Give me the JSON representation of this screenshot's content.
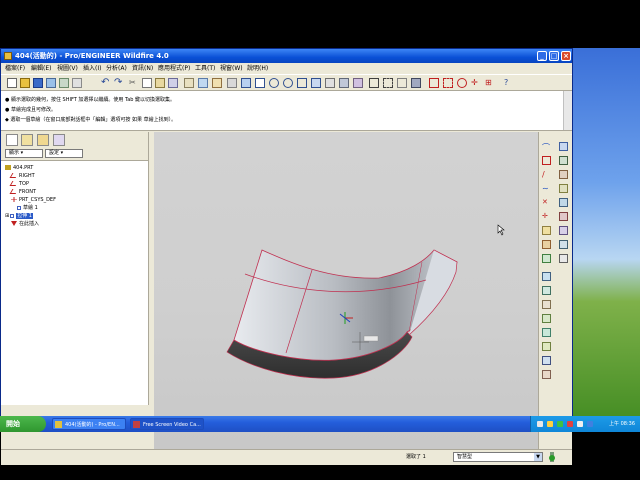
{
  "window": {
    "title": "404(活動的) - Pro/ENGINEER Wildfire 4.0"
  },
  "menu": {
    "items": [
      "檔案(F)",
      "編輯(E)",
      "視圖(V)",
      "插入(I)",
      "分析(A)",
      "資訊(N)",
      "應用程式(P)",
      "工具(T)",
      "視窗(W)",
      "說明(H)"
    ]
  },
  "messages": [
    "● 顯示選取的幾何，按住 SHIFT 加選擇以繼續。使用 Tab 鍵以切換選取集。",
    "● 草繪完成且可修改。",
    "◆ 選取一個草繪（在窗口底部對話框中「編輯」選項可按 如果 草繪上找到）。"
  ],
  "nav": {
    "drop1": "顯示 ▾",
    "drop2": "設定 ▾",
    "tree": [
      {
        "label": "404.PRT",
        "icon": "part"
      },
      {
        "label": "RIGHT",
        "icon": "plane"
      },
      {
        "label": "TOP",
        "icon": "plane"
      },
      {
        "label": "FRONT",
        "icon": "plane"
      },
      {
        "label": "PRT_CSYS_DEF",
        "icon": "csys"
      },
      {
        "label": "草繪 1",
        "icon": "sketch"
      },
      {
        "label": "拉伸 1",
        "icon": "sketch",
        "selected": true
      },
      {
        "label": "在此插入",
        "icon": "insert"
      }
    ]
  },
  "statusbar": {
    "selected": "選取了 1",
    "filter": "智慧型"
  },
  "taskbar": {
    "start": "開始",
    "tasks": [
      "404(活動的) - Pro/EN...",
      "Free Screen Video Ca..."
    ],
    "clock": "上午 08:36"
  }
}
